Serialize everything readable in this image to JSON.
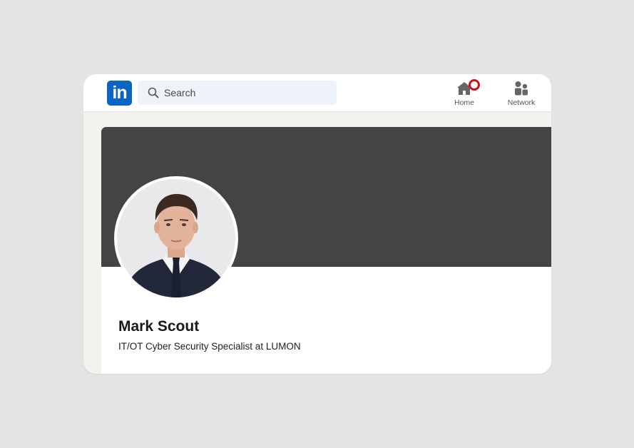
{
  "logo": {
    "text": "in"
  },
  "search": {
    "placeholder": "Search"
  },
  "nav": {
    "home_label": "Home",
    "network_label": "Network"
  },
  "icons": {
    "logo": "linkedin-logo",
    "search": "search-icon",
    "home": "home-icon",
    "network": "network-icon",
    "notification": "notification-badge"
  },
  "colors": {
    "brand": "#0a66c2",
    "banner": "#444444",
    "notification": "#cc1016"
  },
  "profile": {
    "name": "Mark Scout",
    "headline": "IT/OT Cyber Security Specialist at LUMON"
  }
}
